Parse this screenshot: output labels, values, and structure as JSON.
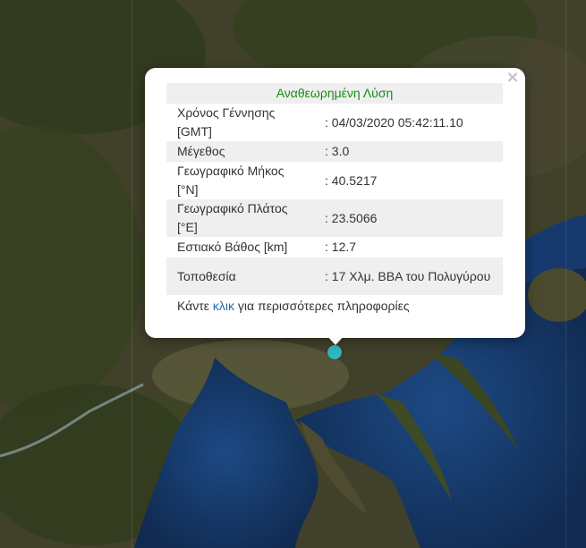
{
  "popup": {
    "title": "Αναθεωρημένη Λύση",
    "close_glyph": "×",
    "rows": [
      {
        "label": "Χρόνος Γέννησης [GMT]",
        "value": ": 04/03/2020 05:42:11.10"
      },
      {
        "label": "Μέγεθος",
        "value": ": 3.0"
      },
      {
        "label": "Γεωγραφικό Μήκος [°N]",
        "value": ": 40.5217"
      },
      {
        "label": "Γεωγραφικό Πλάτος [°E]",
        "value": ": 23.5066"
      },
      {
        "label": "Εστιακό Βάθος [km]",
        "value": ": 12.7"
      },
      {
        "label": "Τοποθεσία",
        "value": ": 17 Χλμ. ΒΒΑ του Πολυγύρου"
      }
    ],
    "footer": {
      "before": "Κάντε ",
      "link": "κλικ",
      "after": " για περισσότερες πληροφορίες"
    }
  },
  "marker": {
    "icon": "epicenter-marker-icon",
    "color": "#32b5c2"
  },
  "colors": {
    "title": "#178a17",
    "link": "#1f6fb0",
    "sea": "#13305a",
    "land": "#4a4a2c"
  }
}
